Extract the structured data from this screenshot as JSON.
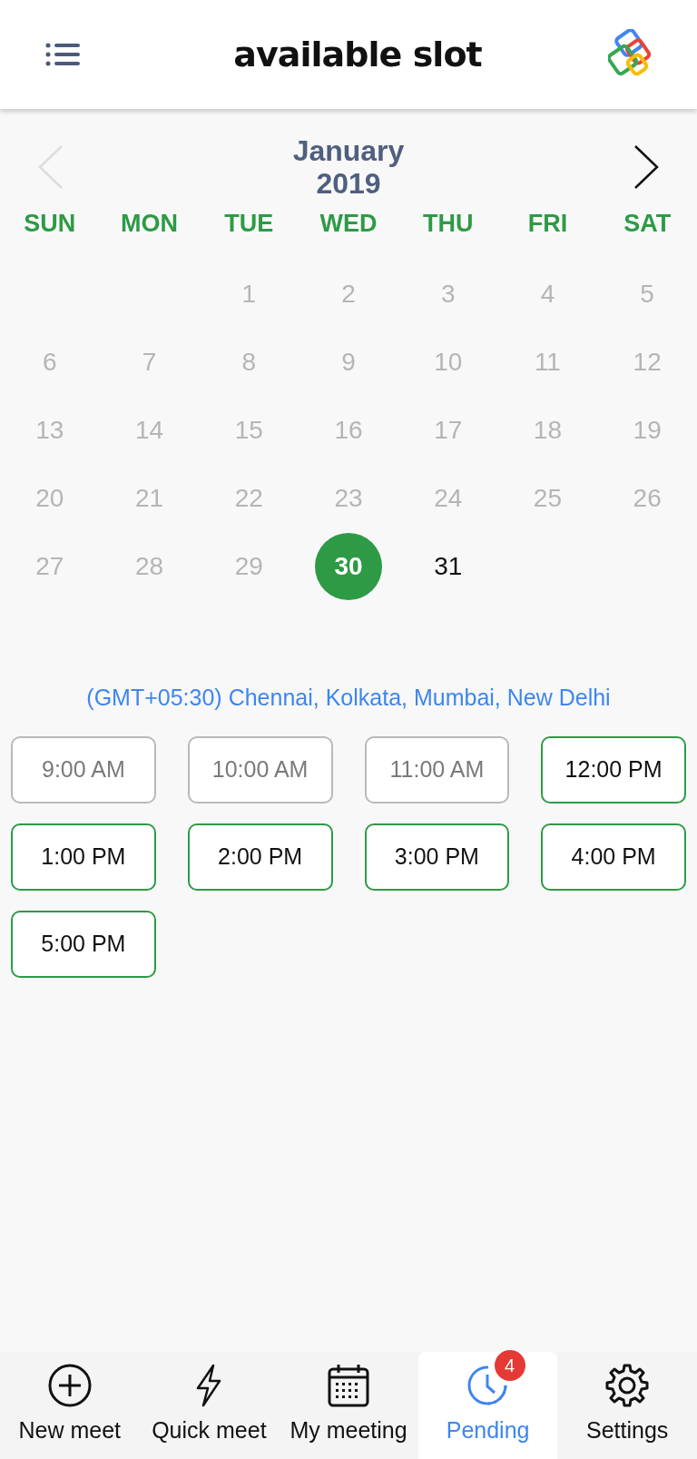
{
  "header": {
    "title": "available slot"
  },
  "calendar": {
    "month": "January",
    "year": "2019",
    "weekdays": [
      "SUN",
      "MON",
      "TUE",
      "WED",
      "THU",
      "FRI",
      "SAT"
    ],
    "weeks": [
      [
        {
          "label": "1",
          "disabled": true,
          "selected": false
        },
        {
          "label": "2",
          "disabled": true,
          "selected": false
        },
        {
          "label": "3",
          "disabled": true,
          "selected": false
        },
        {
          "label": "4",
          "disabled": true,
          "selected": false
        },
        {
          "label": "5",
          "disabled": true,
          "selected": false
        }
      ],
      [
        {
          "label": "6",
          "disabled": true,
          "selected": false
        },
        {
          "label": "7",
          "disabled": true,
          "selected": false
        },
        {
          "label": "8",
          "disabled": true,
          "selected": false
        },
        {
          "label": "9",
          "disabled": true,
          "selected": false
        },
        {
          "label": "10",
          "disabled": true,
          "selected": false
        },
        {
          "label": "11",
          "disabled": true,
          "selected": false
        },
        {
          "label": "12",
          "disabled": true,
          "selected": false
        }
      ],
      [
        {
          "label": "13",
          "disabled": true,
          "selected": false
        },
        {
          "label": "14",
          "disabled": true,
          "selected": false
        },
        {
          "label": "15",
          "disabled": true,
          "selected": false
        },
        {
          "label": "16",
          "disabled": true,
          "selected": false
        },
        {
          "label": "17",
          "disabled": true,
          "selected": false
        },
        {
          "label": "18",
          "disabled": true,
          "selected": false
        },
        {
          "label": "19",
          "disabled": true,
          "selected": false
        }
      ],
      [
        {
          "label": "20",
          "disabled": true,
          "selected": false
        },
        {
          "label": "21",
          "disabled": true,
          "selected": false
        },
        {
          "label": "22",
          "disabled": true,
          "selected": false
        },
        {
          "label": "23",
          "disabled": true,
          "selected": false
        },
        {
          "label": "24",
          "disabled": true,
          "selected": false
        },
        {
          "label": "25",
          "disabled": true,
          "selected": false
        },
        {
          "label": "26",
          "disabled": true,
          "selected": false
        }
      ],
      [
        {
          "label": "27",
          "disabled": true,
          "selected": false
        },
        {
          "label": "28",
          "disabled": true,
          "selected": false
        },
        {
          "label": "29",
          "disabled": true,
          "selected": false
        },
        {
          "label": "30",
          "disabled": false,
          "selected": true
        },
        {
          "label": "31",
          "disabled": false,
          "selected": false
        }
      ]
    ],
    "prev_disabled": true
  },
  "timezone": "(GMT+05:30) Chennai, Kolkata, Mumbai, New Delhi",
  "slots": [
    {
      "label": "9:00 AM",
      "disabled": true
    },
    {
      "label": "10:00 AM",
      "disabled": true
    },
    {
      "label": "11:00 AM",
      "disabled": true
    },
    {
      "label": "12:00 PM",
      "disabled": false
    },
    {
      "label": "1:00 PM",
      "disabled": false
    },
    {
      "label": "2:00 PM",
      "disabled": false
    },
    {
      "label": "3:00 PM",
      "disabled": false
    },
    {
      "label": "4:00 PM",
      "disabled": false
    },
    {
      "label": "5:00 PM",
      "disabled": false
    }
  ],
  "nav": [
    {
      "kind": "plus",
      "label": "New meet",
      "selected": false
    },
    {
      "kind": "bolt",
      "label": "Quick meet",
      "selected": false
    },
    {
      "kind": "calendar",
      "label": "My meeting",
      "selected": false
    },
    {
      "kind": "clock",
      "label": "Pending",
      "selected": true,
      "badge": "4"
    },
    {
      "kind": "gear",
      "label": "Settings",
      "selected": false
    }
  ]
}
